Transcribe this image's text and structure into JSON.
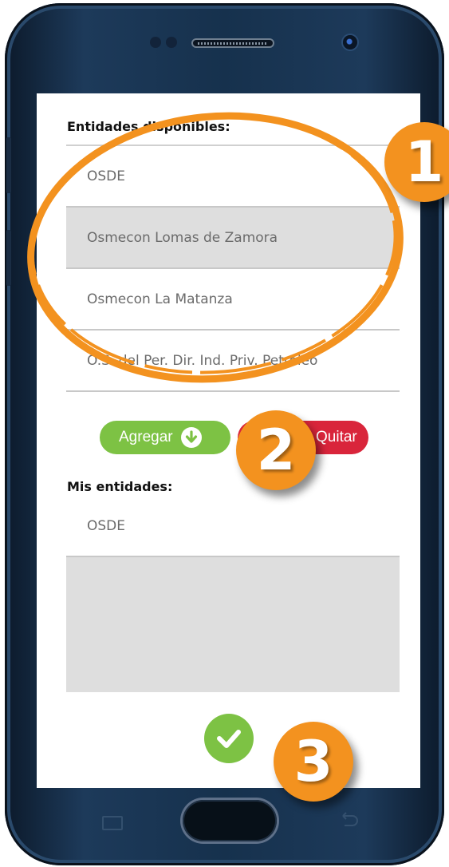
{
  "available": {
    "title": "Entidades disponibles:",
    "items": [
      {
        "label": "OSDE"
      },
      {
        "label": "Osmecon Lomas de Zamora"
      },
      {
        "label": "Osmecon La Matanza"
      },
      {
        "label": "O.S. del Per. Dir. Ind. Priv. Petróleo"
      }
    ],
    "selected_index": 1
  },
  "actions": {
    "add_label": "Agregar",
    "remove_label": "Quitar",
    "add_color": "#7dc244",
    "remove_color": "#d9253b"
  },
  "mine": {
    "title": "Mis entidades:",
    "items": [
      {
        "label": "OSDE"
      }
    ]
  },
  "confirm": {
    "icon": "check-icon",
    "color": "#7dc244"
  },
  "annotations": {
    "badge_1": "1",
    "badge_2": "2",
    "badge_3": "3",
    "color": "#f3921f"
  }
}
